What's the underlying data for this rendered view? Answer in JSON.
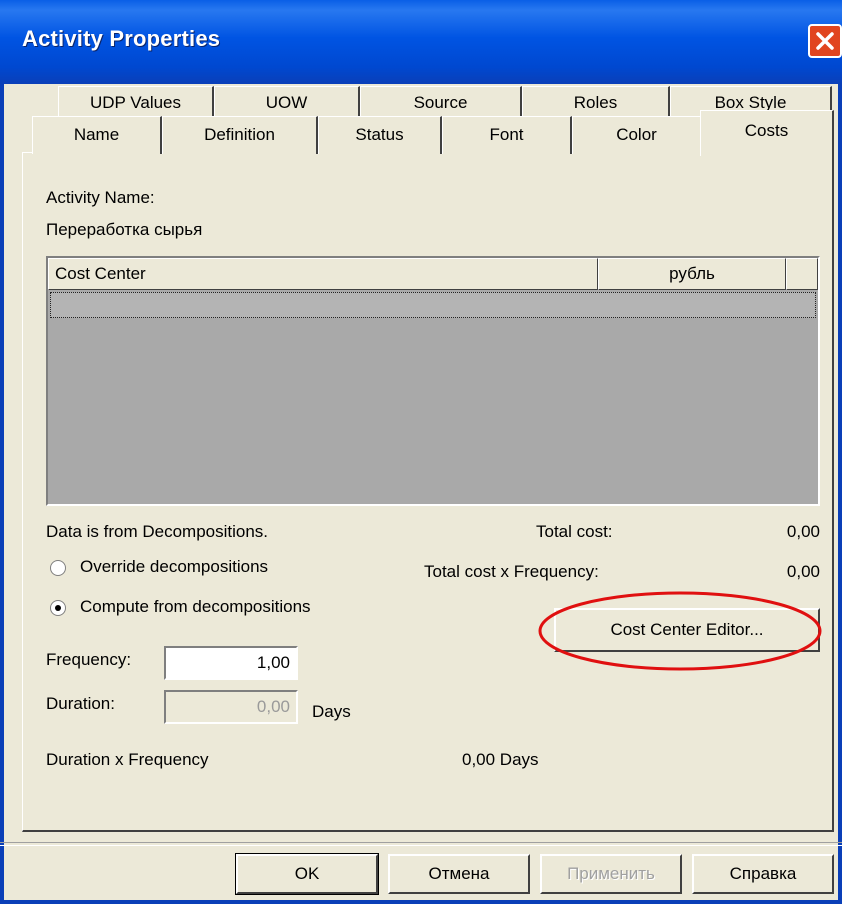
{
  "window": {
    "title": "Activity Properties"
  },
  "tabs": {
    "row1": [
      "UDP Values",
      "UOW",
      "Source",
      "Roles",
      "Box Style"
    ],
    "row2": [
      "Name",
      "Definition",
      "Status",
      "Font",
      "Color",
      "Costs"
    ],
    "active": "Costs"
  },
  "costs": {
    "activity_name_label": "Activity Name:",
    "activity_name_value": "Переработка сырья",
    "grid": {
      "col_cost_center": "Cost Center",
      "col_currency": "рубль"
    },
    "data_source_text": "Data is from Decompositions.",
    "total_cost_label": "Total cost:",
    "total_cost_value": "0,00",
    "total_cost_freq_label": "Total cost x Frequency:",
    "total_cost_freq_value": "0,00",
    "radio_override": "Override decompositions",
    "radio_compute": "Compute from decompositions",
    "radio_selected": "compute",
    "cost_center_editor_label": "Cost Center Editor...",
    "frequency_label": "Frequency:",
    "frequency_value": "1,00",
    "duration_label": "Duration:",
    "duration_value": "0,00",
    "duration_unit": "Days",
    "duration_freq_label": "Duration x Frequency",
    "duration_freq_value": "0,00 Days"
  },
  "buttons": {
    "ok": "OK",
    "cancel": "Отмена",
    "apply": "Применить",
    "help": "Справка"
  },
  "colors": {
    "titlebar": "#0054e3",
    "close": "#e1451f",
    "highlight_ellipse": "#e01010"
  }
}
